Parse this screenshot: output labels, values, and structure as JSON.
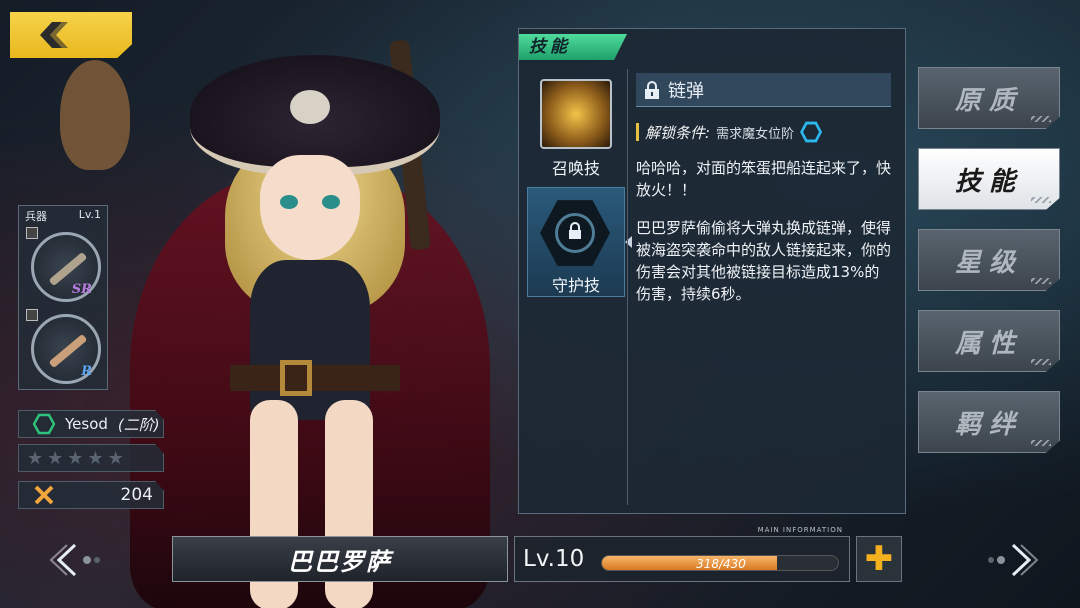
{
  "character": {
    "name": "巴巴罗萨",
    "level": "Lv.10",
    "exp_text": "318/430",
    "exp_ratio": 0.74
  },
  "weapon_panel": {
    "label": "兵器",
    "level": "Lv.1",
    "slots": [
      {
        "rank": "SR",
        "rank_color": "#b77ce0"
      },
      {
        "rank": "R",
        "rank_color": "#5fa6f0"
      }
    ]
  },
  "stats": {
    "sephira": "Yesod",
    "sephira_tier": "(二阶)",
    "power": "204"
  },
  "skills_window": {
    "tab_title": "技能",
    "skill_list": [
      {
        "name": "召唤技",
        "active": false
      },
      {
        "name": "守护技",
        "active": true
      }
    ],
    "detail": {
      "title": "链弹",
      "unlock_label": "解锁条件:",
      "unlock_value": "需求魔女位阶",
      "quote": "哈哈哈，对面的笨蛋把船连起来了，快放火！！",
      "description": "巴巴罗萨偷偷将大弹丸换成链弹，使得被海盗突袭命中的敌人链接起来，你的伤害会对其他被链接目标造成13%的伤害，持续6秒。"
    }
  },
  "side_tabs": [
    {
      "label": "原质",
      "active": false
    },
    {
      "label": "技能",
      "active": true
    },
    {
      "label": "星级",
      "active": false
    },
    {
      "label": "属性",
      "active": false
    },
    {
      "label": "羁绊",
      "active": false
    }
  ],
  "main_information_label": "MAIN INFORMATION",
  "icons": {
    "back": "chevron-left-icon",
    "prev": "prev-arrow-icon",
    "next": "next-arrow-icon",
    "plus": "plus-icon",
    "lock": "lock-icon"
  },
  "colors": {
    "accent_green": "#2ec27e",
    "accent_gold": "#f5b020",
    "exp_orange": "#e08a2e"
  }
}
